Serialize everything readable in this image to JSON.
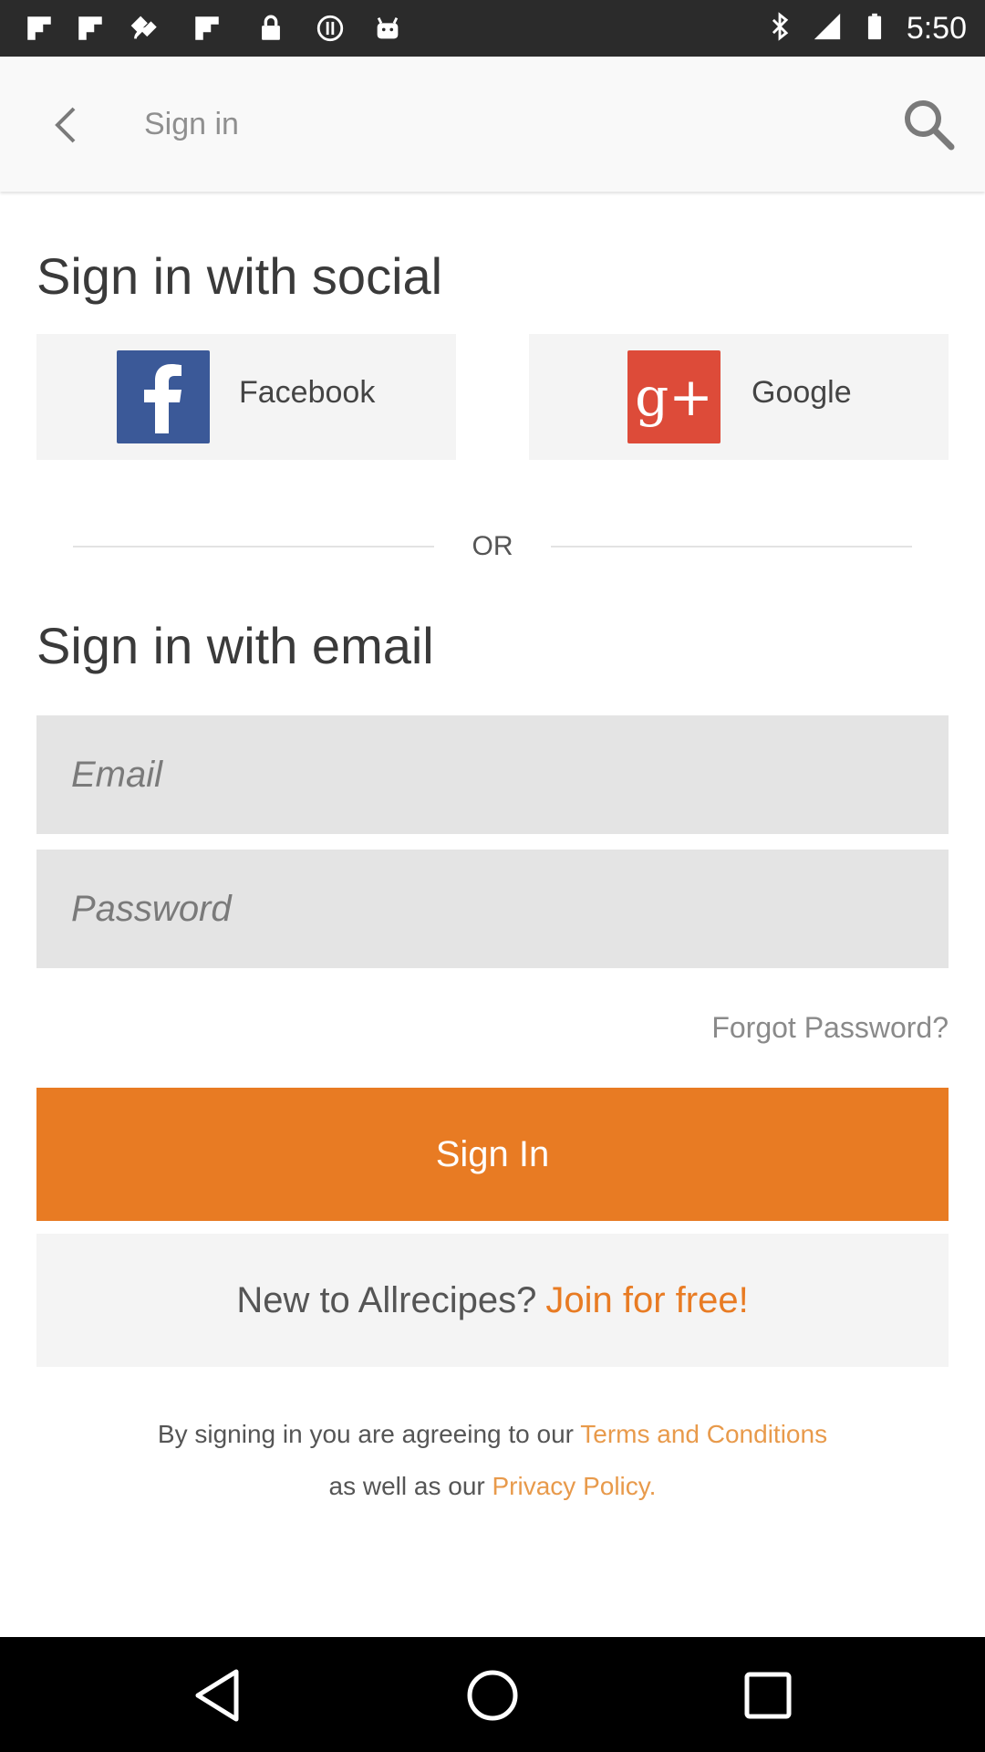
{
  "status_bar": {
    "time": "5:50",
    "left_icons": [
      "flipboard-icon",
      "flipboard-icon",
      "fake-gps-icon",
      "flipboard-icon",
      "lock-icon",
      "sync-icon",
      "android-icon"
    ],
    "right_icons": [
      "bluetooth-icon",
      "signal-icon",
      "battery-icon"
    ]
  },
  "app_bar": {
    "title": "Sign in",
    "back_icon": "chevron-left-icon",
    "search_icon": "search-icon"
  },
  "social": {
    "heading": "Sign in with social",
    "facebook_label": "Facebook",
    "google_label": "Google",
    "facebook_color": "#3b5998",
    "google_color": "#dd4b39"
  },
  "divider_text": "OR",
  "email_section": {
    "heading": "Sign in with email",
    "email_placeholder": "Email",
    "password_placeholder": "Password",
    "forgot_password": "Forgot Password?"
  },
  "sign_in_button": "Sign In",
  "join": {
    "prompt": "New to Allrecipes?",
    "link": "Join for free!"
  },
  "legal": {
    "line1_prefix": "By signing in you are agreeing to our",
    "terms_link": "Terms and Conditions",
    "line2_prefix": "as well as our",
    "privacy_link": "Privacy Policy."
  },
  "accent_color": "#e87b23",
  "nav_bar": {
    "icons": [
      "back-triangle-icon",
      "home-circle-icon",
      "recents-square-icon"
    ]
  }
}
